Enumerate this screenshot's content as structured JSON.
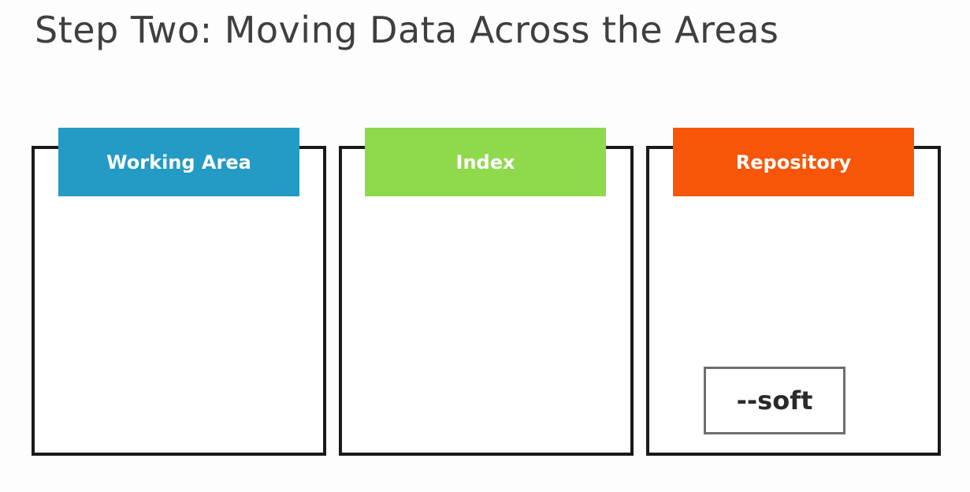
{
  "title": "Step Two: Moving Data Across the Areas",
  "areas": [
    {
      "label": "Working Area",
      "color": "#239bc4"
    },
    {
      "label": "Index",
      "color": "#8fd94d"
    },
    {
      "label": "Repository",
      "color": "#f75609"
    }
  ],
  "repository_option": "--soft"
}
